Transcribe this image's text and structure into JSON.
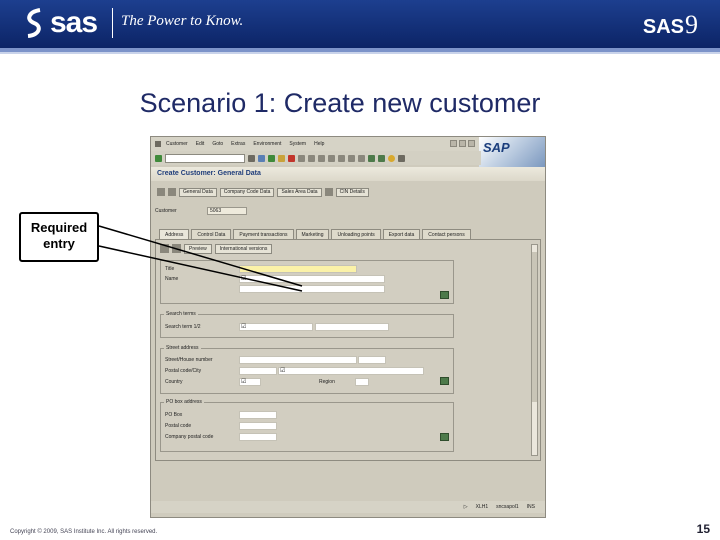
{
  "slide": {
    "brand": "sas",
    "tagline": "The Power to Know.",
    "product": "SAS",
    "product_version": "9",
    "title": "Scenario 1: Create new customer",
    "callout": "Required entry",
    "copyright": "Copyright © 2009, SAS Institute Inc. All rights reserved.",
    "page_number": "15"
  },
  "sap": {
    "logo": "SAP",
    "menu": [
      "Customer",
      "Edit",
      "Goto",
      "Extras",
      "Environment",
      "System",
      "Help"
    ],
    "window_title": "Create Customer: General Data",
    "toolbar_buttons": [
      "General Data",
      "Company Code Data",
      "Sales Area Data",
      "CIN Details"
    ],
    "customer_label": "Customer",
    "customer_number": "5063",
    "tabs": [
      "Address",
      "Control Data",
      "Payment transactions",
      "Marketing",
      "Unloading points",
      "Export data",
      "Contact persons"
    ],
    "panel_buttons": [
      "Preview",
      "International versions"
    ],
    "name_group": {
      "title_label": "Title",
      "name_label": "Name"
    },
    "search_group": {
      "title": "Search terms",
      "label": "Search term 1/2"
    },
    "street_group": {
      "title": "Street address",
      "street_label": "Street/House number",
      "postal_label": "Postal code/City",
      "country_label": "Country",
      "region_label": "Region"
    },
    "pobox_group": {
      "title": "PO box address",
      "pobox_label": "PO Box",
      "postal_label": "Postal code",
      "company_label": "Company postal code"
    },
    "status": [
      "XLH1",
      "sncsapol1",
      "INS"
    ]
  },
  "colors": {
    "header_blue": "#0c2466",
    "title_blue": "#1f2a66",
    "required_field": "#fbf2a8"
  }
}
